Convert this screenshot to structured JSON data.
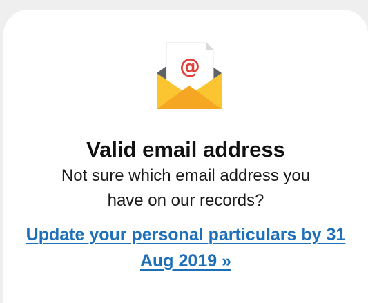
{
  "card": {
    "icon": "email-envelope-at-icon",
    "title": "Valid email address",
    "description": "Not sure which email address you have on our records?",
    "link_text": "Update your personal particulars by 31 Aug 2019 »"
  },
  "colors": {
    "background": "#efeff0",
    "card": "#ffffff",
    "link": "#1d6fb8",
    "envelope_yellow": "#fbc531",
    "envelope_dark": "#5f6368",
    "at_symbol": "#e0403a"
  }
}
